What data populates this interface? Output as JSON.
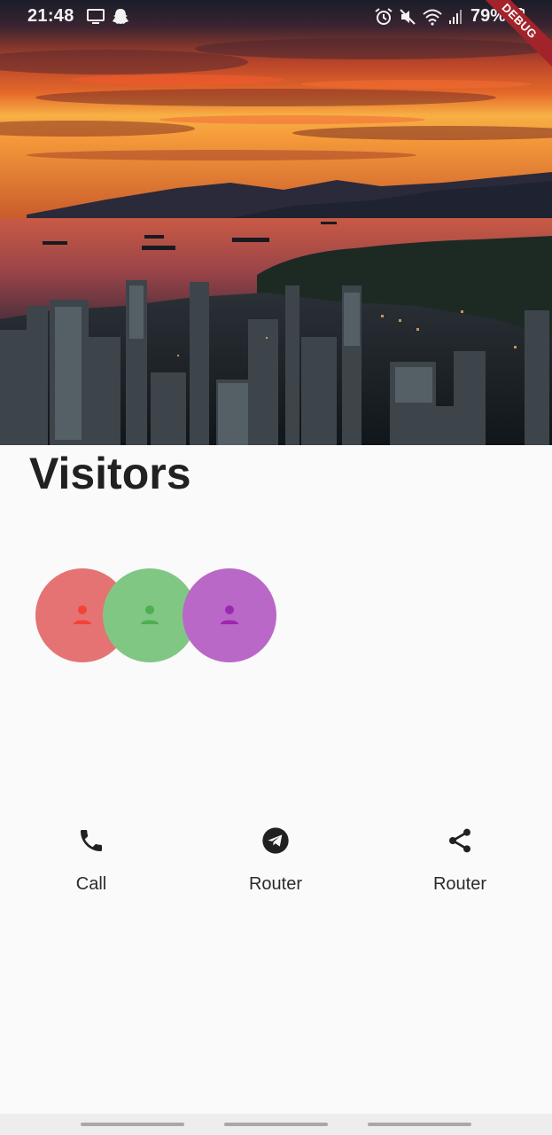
{
  "status_bar": {
    "time": "21:48",
    "battery_percent": "79%",
    "left_icons": [
      "monitor-icon",
      "snapchat-ghost-icon"
    ],
    "right_icons": [
      "alarm-icon",
      "mute-icon",
      "wifi-icon",
      "signal-icon",
      "battery-icon"
    ],
    "debug_banner": "DEBUG"
  },
  "hero": {
    "image": "sunset-city-harbor-photo"
  },
  "title": "Visitors",
  "visitors": [
    {
      "icon": "person-icon",
      "bg_color": "#e57373",
      "icon_color": "#f44336"
    },
    {
      "icon": "person-icon",
      "bg_color": "#81c784",
      "icon_color": "#4caf50"
    },
    {
      "icon": "person-icon",
      "bg_color": "#ba68c8",
      "icon_color": "#9c27b0"
    }
  ],
  "actions": [
    {
      "label": "Call",
      "icon": "phone-icon"
    },
    {
      "label": "Router",
      "icon": "telegram-icon"
    },
    {
      "label": "Router",
      "icon": "share-icon"
    }
  ]
}
